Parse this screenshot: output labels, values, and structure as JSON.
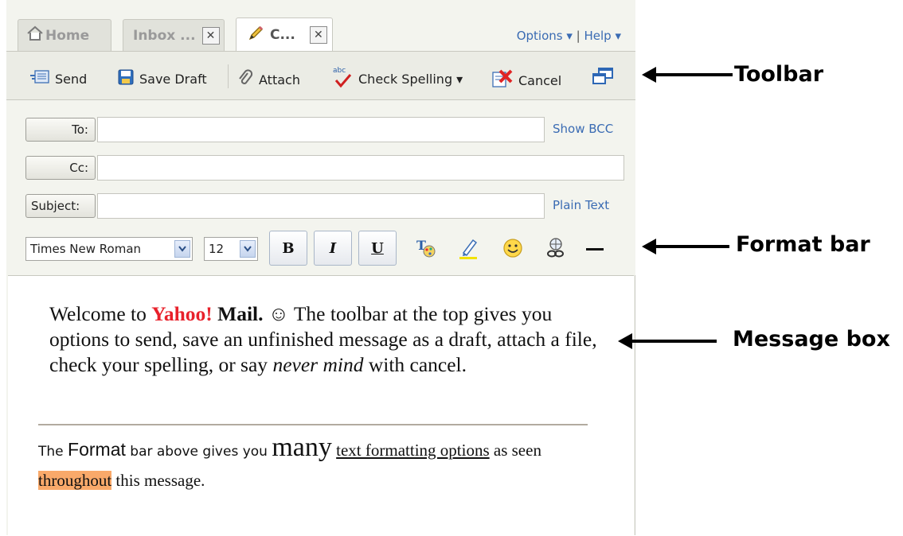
{
  "tabs": [
    {
      "label": "Home",
      "icon": "home-icon",
      "active": false
    },
    {
      "label": "Inbox ...",
      "icon": "",
      "active": false
    },
    {
      "label": "C...",
      "icon": "pencil-icon",
      "active": true
    }
  ],
  "top_links": {
    "options": "Options ▾",
    "separator": "|",
    "help": "Help ▾"
  },
  "toolbar": {
    "send": "Send",
    "save_draft": "Save Draft",
    "attach": "Attach",
    "check_spelling": "Check Spelling ▾",
    "spell_icon_text": "abc",
    "cancel": "Cancel"
  },
  "fields": {
    "to_label": "To:",
    "cc_label": "Cc:",
    "subject_label": "Subject:",
    "to_value": "",
    "cc_value": "",
    "subject_value": "",
    "show_bcc": "Show BCC",
    "plain_text": "Plain Text"
  },
  "format_bar": {
    "font_family": "Times New Roman",
    "font_size": "12",
    "bold": "B",
    "italic": "I",
    "underline": "U"
  },
  "message": {
    "p1_a": "Welcome to ",
    "p1_yahoo": "Yahoo!",
    "p1_mail": " Mail.",
    "p1_smiley": " ☺",
    "p1_b": " The toolbar at the top gives you options to send, save an unfinished message as a draft, attach a file, check your spelling, or say ",
    "p1_never": "never mind",
    "p1_c": " with cancel.",
    "p2_a": "The ",
    "p2_format": "Format",
    "p2_b": " bar above gives you ",
    "p2_many": "many",
    "p2_c": " ",
    "p2_textfmt": "text formatting options",
    "p2_d": " as seen ",
    "p2_throughout": "throughout",
    "p2_e": " this message."
  },
  "annotations": {
    "toolbar": "Toolbar",
    "format_bar": "Format bar",
    "message_box": "Message box"
  },
  "colors": {
    "link": "#3a6bb3",
    "yahoo_red": "#e8212b",
    "highlight": "#f9a96a",
    "annotation": "#000000"
  }
}
